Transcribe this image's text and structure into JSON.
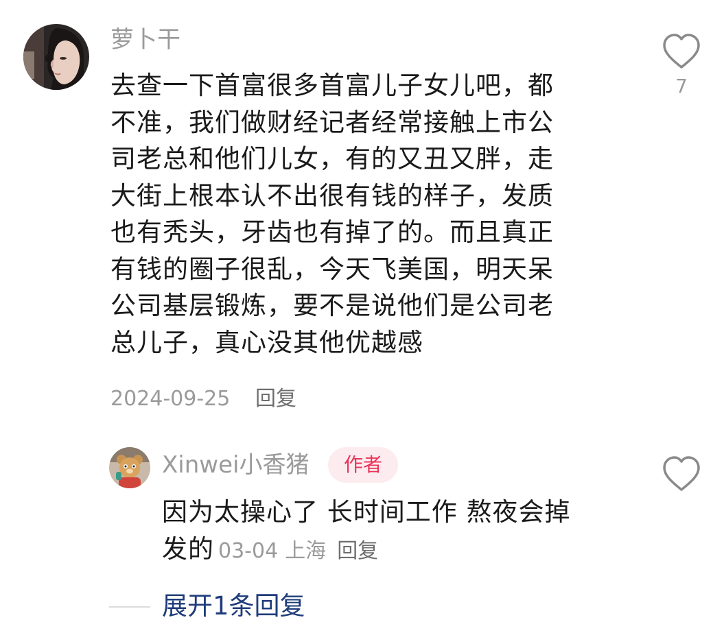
{
  "comment": {
    "username": "萝卜干",
    "avatar_icon": "user-avatar-icon",
    "text_lines": [
      "去查一下首富很多首富儿子女儿吧，都",
      "不准，我们做财经记者经常接触上市公",
      "司老总和他们儿女，有的又丑又胖，走",
      "大街上根本认不出很有钱的样子，发质",
      "也有秃头，牙齿也有掉了的。而且真正",
      "有钱的圈子很乱，今天飞美国，明天呆",
      "公司基层锻炼，要不是说他们是公司老",
      "总儿子，真心没其他优越感"
    ],
    "date": "2024-09-25",
    "reply_label": "回复",
    "like_icon": "heart-outline-icon",
    "like_count": "7"
  },
  "reply": {
    "username": "Xinwei小香猪",
    "avatar_icon": "bear-avatar-icon",
    "author_badge": "作者",
    "text_line_1": "因为太操心了 长时间工作 熬夜会掉",
    "text_line_2": "发的",
    "date": "03-04",
    "location": "上海",
    "reply_label": "回复",
    "like_icon": "heart-outline-icon"
  },
  "expand_label": "展开1条回复",
  "colors": {
    "username": "#9a9a9a",
    "text": "#1a1a1a",
    "badge_bg": "#fdecef",
    "badge_text": "#e8345a",
    "expand_link": "#1f3c7a"
  }
}
